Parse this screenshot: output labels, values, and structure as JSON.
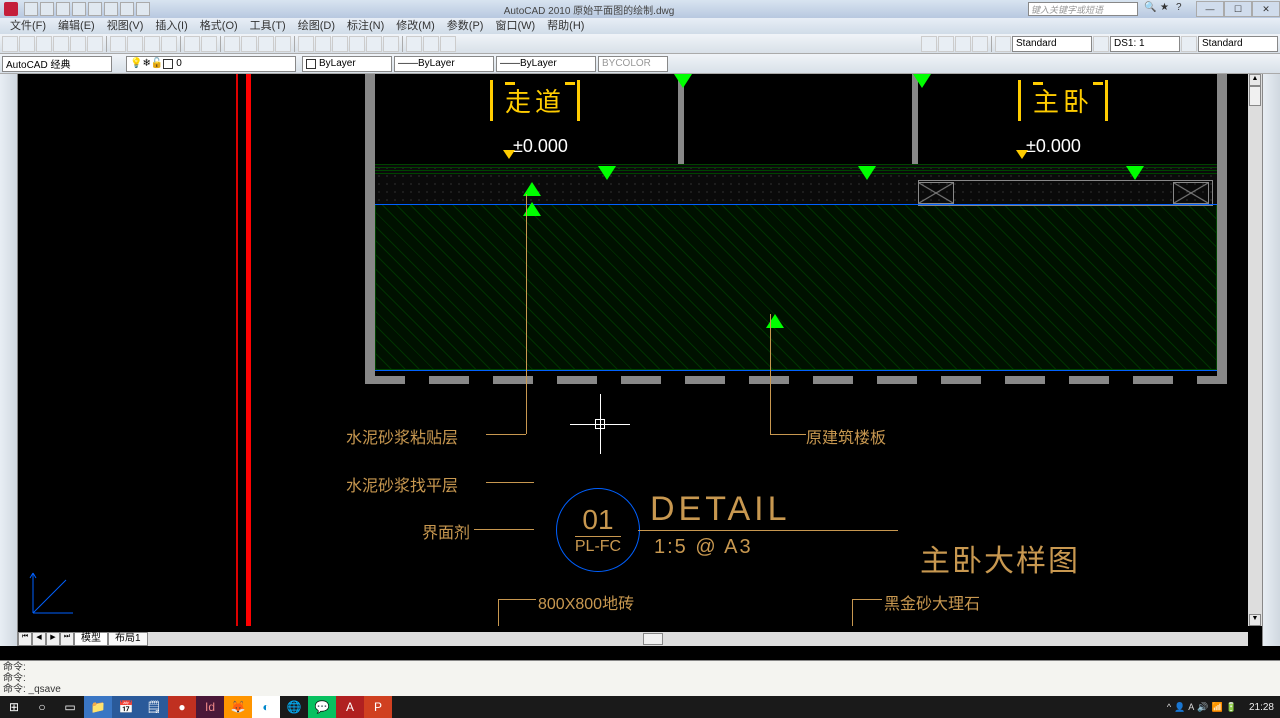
{
  "title": "AutoCAD 2010    原始平面图的绘制.dwg",
  "search_placeholder": "键入关键字或短语",
  "menus": [
    "文件(F)",
    "编辑(E)",
    "视图(V)",
    "插入(I)",
    "格式(O)",
    "工具(T)",
    "绘图(D)",
    "标注(N)",
    "修改(M)",
    "参数(P)",
    "窗口(W)",
    "帮助(H)"
  ],
  "workspace_combo": "AutoCAD 经典",
  "layer_combo": "0",
  "linetype_combo1": "ByLayer",
  "linetype_combo2": "ByLayer",
  "linetype_combo3": "ByLayer",
  "bycolor": "BYCOLOR",
  "text_style": "Standard",
  "dim_style_label": "DS1: 1",
  "table_style": "Standard",
  "tabs": {
    "model": "模型",
    "layout1": "布局1"
  },
  "cmd": {
    "l1": "命令:",
    "l2": "命令:",
    "l3": "命令: _qsave"
  },
  "drawing": {
    "room1": "走道",
    "room2": "主卧",
    "elev1": "±0.000",
    "elev2": "±0.000",
    "label1": "水泥砂浆粘贴层",
    "label2": "水泥砂浆找平层",
    "label3": "界面剂",
    "label4": "原建筑楼板",
    "label5": "800X800地砖",
    "label6": "黑金砂大理石",
    "circle_top": "01",
    "circle_bot": "PL-FC",
    "detail": "DETAIL",
    "scale": "1:5 @ A3",
    "title_big": "主卧大样图"
  },
  "clock": "21:28",
  "winbtns": {
    "min": "—",
    "max": "☐",
    "close": "✕"
  }
}
